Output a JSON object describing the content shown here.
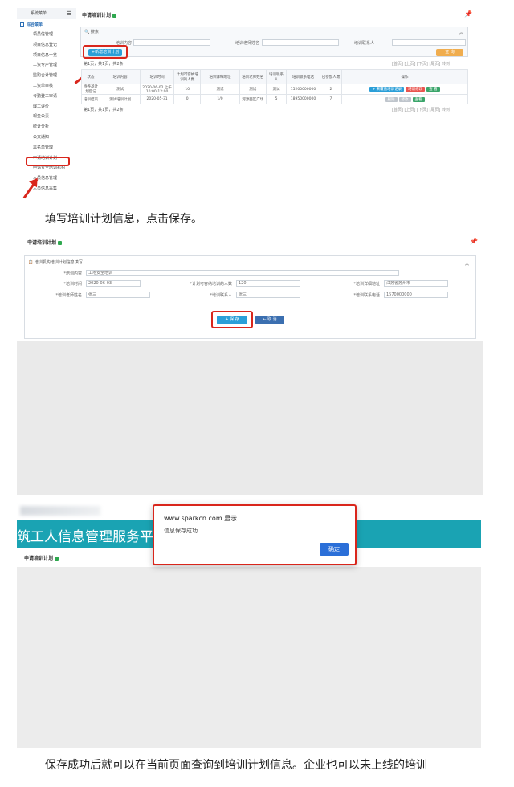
{
  "shot1": {
    "sidebar": {
      "header": "系统菜单",
      "group": "综合菜单",
      "items": [
        "领员信管理",
        "项目信息登记",
        "项目信息一览",
        "工资专户管理",
        "监购合计管理",
        "工资单审核",
        "考勤登工审请",
        "爆工评价",
        "现金公责",
        "统计分析",
        "公文通知",
        "黑名单管理",
        "申请培训计划",
        "申请安全培训机构",
        "人员信息管理",
        "人员信息采集"
      ]
    },
    "title": "申请培训计划",
    "search_label": "搜索",
    "filters": [
      "培训内容",
      "培训老师姓名",
      "培训联系人"
    ],
    "add_button": "+新增培训计划",
    "search_button": "查 询",
    "pager_top": "第1页，共1页，共2条",
    "pager_right": "[首页] [上页] [下页] [尾页] 转到",
    "columns": [
      "状态",
      "培训内容",
      "培训时间",
      "计划可容纳培训的人数",
      "培训详细地址",
      "培训老师姓名",
      "培训联系人",
      "培训联系电话",
      "已参加人数",
      "操作"
    ],
    "rows": [
      {
        "status": "待养基计划登记",
        "content": "测试",
        "time": "2020-06-02 上午10:00-12:00",
        "cap": "10",
        "addr": "测试",
        "teacher": "测试",
        "contact": "测试",
        "phone": "15200000000",
        "joined": "2"
      },
      {
        "status": "培训结束",
        "content": "测试培训计划",
        "time": "2020-05-31",
        "cap": "0",
        "addr": "1/0",
        "teacher": "河源西区广场",
        "contact": "5",
        "phone": "18950000000",
        "joined": "7"
      }
    ],
    "row_actions": [
      "+ 来覆盖培训记录",
      "培训修改",
      "查 看"
    ],
    "row2_actions": [
      "删除",
      "修改",
      "查看"
    ]
  },
  "caption1": "填写培训计划信息，点击保存。",
  "shot2": {
    "title": "申请培训计划",
    "section": "培训机构培训计划信息填写",
    "fields": {
      "content_label": "*培训内容",
      "content_value": "工地安全培训",
      "time_label": "*培训时间",
      "time_value": "2020-06-03",
      "cap_label": "*计划可容纳培训的人数",
      "cap_value": "120",
      "addr_label": "*培训详细地址",
      "addr_value": "江苏省苏州市",
      "teacher_label": "*培训老师姓名",
      "teacher_value": "张三",
      "contact_label": "*培训联系人",
      "contact_value": "张三",
      "phone_label": "*培训联系电话",
      "phone_value": "1570000000"
    },
    "save_button": "+ 保 存",
    "cancel_button": "← 取 消"
  },
  "shot3": {
    "banner": "筑工人信息管理服务平台（",
    "title": "申请培训计划",
    "dialog_site": "www.sparkcn.com 显示",
    "dialog_msg": "信息保存成功",
    "ok_button": "确定"
  },
  "caption2": "保存成功后就可以在当前页面查询到培训计划信息。企业也可以未上线的培训",
  "colors": {
    "accent": "#2b9fd8",
    "red": "#d9261c",
    "teal": "#1aa3b3",
    "green": "#2fa84f"
  }
}
